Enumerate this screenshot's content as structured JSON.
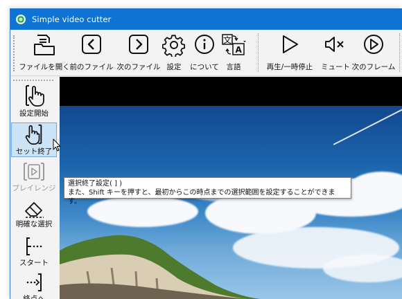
{
  "window": {
    "title": "Simple video cutter"
  },
  "toolbar": {
    "open_file": "ファイルを開く",
    "prev_file": "前のファイル",
    "next_file": "次のファイル",
    "settings": "設定",
    "about": "について",
    "language": "言語",
    "play_pause": "再生/一時停止",
    "mute": "ミュート",
    "next_frame": "次のフレーム"
  },
  "sidebar": {
    "set_start": "設定開始",
    "set_end": "セット終了",
    "preview_range": "プレイレンジ",
    "clear_selection": "明確な選択",
    "go_start": "スタート",
    "go_end": "終点へ"
  },
  "tooltip": {
    "line1": "選択終了設定( ] )",
    "line2": "また、Shift キーを押すと、最初からこの時点までの選択範囲を設定することができます。"
  },
  "icons": {
    "app": "app-icon",
    "open_file": "folder-icon",
    "prev_file": "chevron-left-icon",
    "next_file": "chevron-right-icon",
    "settings": "gear-icon",
    "about": "info-icon",
    "language": "translate-icon",
    "play_pause": "play-icon",
    "mute": "speaker-mute-icon",
    "next_frame": "next-frame-icon"
  },
  "colors": {
    "titlebar": "#0f73d4",
    "selected": "#cde4f7"
  }
}
